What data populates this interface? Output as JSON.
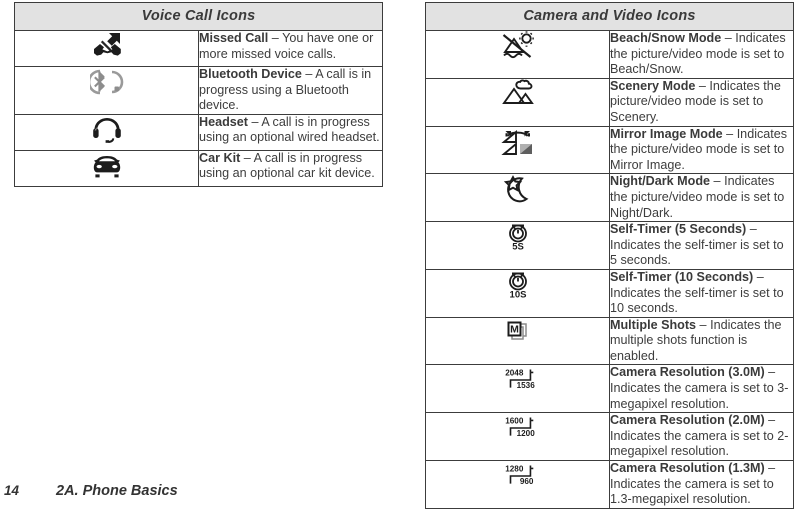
{
  "page": {
    "footer": {
      "page_number": "14",
      "section_title": "2A. Phone Basics"
    }
  },
  "voice_call_table": {
    "caption": "Voice Call Icons",
    "rows": [
      {
        "icon": "missed-call-icon",
        "label": "Missed Call",
        "dash": " – ",
        "description": "You have one or more missed voice calls."
      },
      {
        "icon": "bluetooth-device-icon",
        "label": "Bluetooth Device",
        "dash": " – ",
        "description": "A call is in progress using a Bluetooth device."
      },
      {
        "icon": "headset-icon",
        "label": "Headset",
        "dash": " – ",
        "description": "A call is in progress using an optional wired headset."
      },
      {
        "icon": "car-kit-icon",
        "label": "Car Kit",
        "dash": " – ",
        "description": "A call is in progress using an optional car kit device."
      }
    ]
  },
  "camera_video_table": {
    "caption": "Camera and Video Icons",
    "rows": [
      {
        "icon": "beach-snow-mode-icon",
        "label": "Beach/Snow Mode",
        "dash": " – ",
        "description": "Indicates the picture/video mode is set to Beach/Snow."
      },
      {
        "icon": "scenery-mode-icon",
        "label": "Scenery Mode",
        "dash": " – ",
        "description": "Indicates the picture/video mode is set to Scenery."
      },
      {
        "icon": "mirror-image-mode-icon",
        "label": "Mirror Image Mode",
        "dash": " – ",
        "description": "Indicates the picture/video mode is set to Mirror Image."
      },
      {
        "icon": "night-dark-mode-icon",
        "label": "Night/Dark Mode",
        "dash": " – ",
        "description": "Indicates the picture/video mode is set to Night/Dark."
      },
      {
        "icon": "self-timer-5-seconds-icon",
        "label": "Self-Timer (5 Seconds)",
        "dash": " – ",
        "description": " Indicates the self-timer is set to 5 seconds.",
        "icon_text": "5S"
      },
      {
        "icon": "self-timer-10-seconds-icon",
        "label": "Self-Timer (10 Seconds)",
        "dash": " – ",
        "description": " Indicates the self-timer is set to 10 seconds.",
        "icon_text": "10S"
      },
      {
        "icon": "multiple-shots-icon",
        "label": "Multiple Shots",
        "dash": " – ",
        "description": "Indicates the multiple shots function is enabled.",
        "icon_text": "M"
      },
      {
        "icon": "camera-resolution-3m-icon",
        "label": "Camera Resolution (3.0M)",
        "dash": " – ",
        "description": "Indicates the camera is set to 3-megapixel resolution.",
        "icon_text_top": "2048",
        "icon_text_bottom": "1536"
      },
      {
        "icon": "camera-resolution-2m-icon",
        "label": "Camera Resolution (2.0M)",
        "dash": " – ",
        "description": "Indicates the camera is set to 2-megapixel resolution.",
        "icon_text_top": "1600",
        "icon_text_bottom": "1200"
      },
      {
        "icon": "camera-resolution-1-3m-icon",
        "label": "Camera Resolution (1.3M)",
        "dash": " – ",
        "description": "Indicates the camera is set to 1.3-megapixel resolution.",
        "icon_text_top": "1280",
        "icon_text_bottom": "960"
      }
    ]
  },
  "colors": {
    "caption_background": "#e2e2e2",
    "border": "#3c3c3c",
    "label_text": "#3a3a3a",
    "body_text": "#3d3d3d",
    "icon_fill": "#1c1c1c"
  }
}
